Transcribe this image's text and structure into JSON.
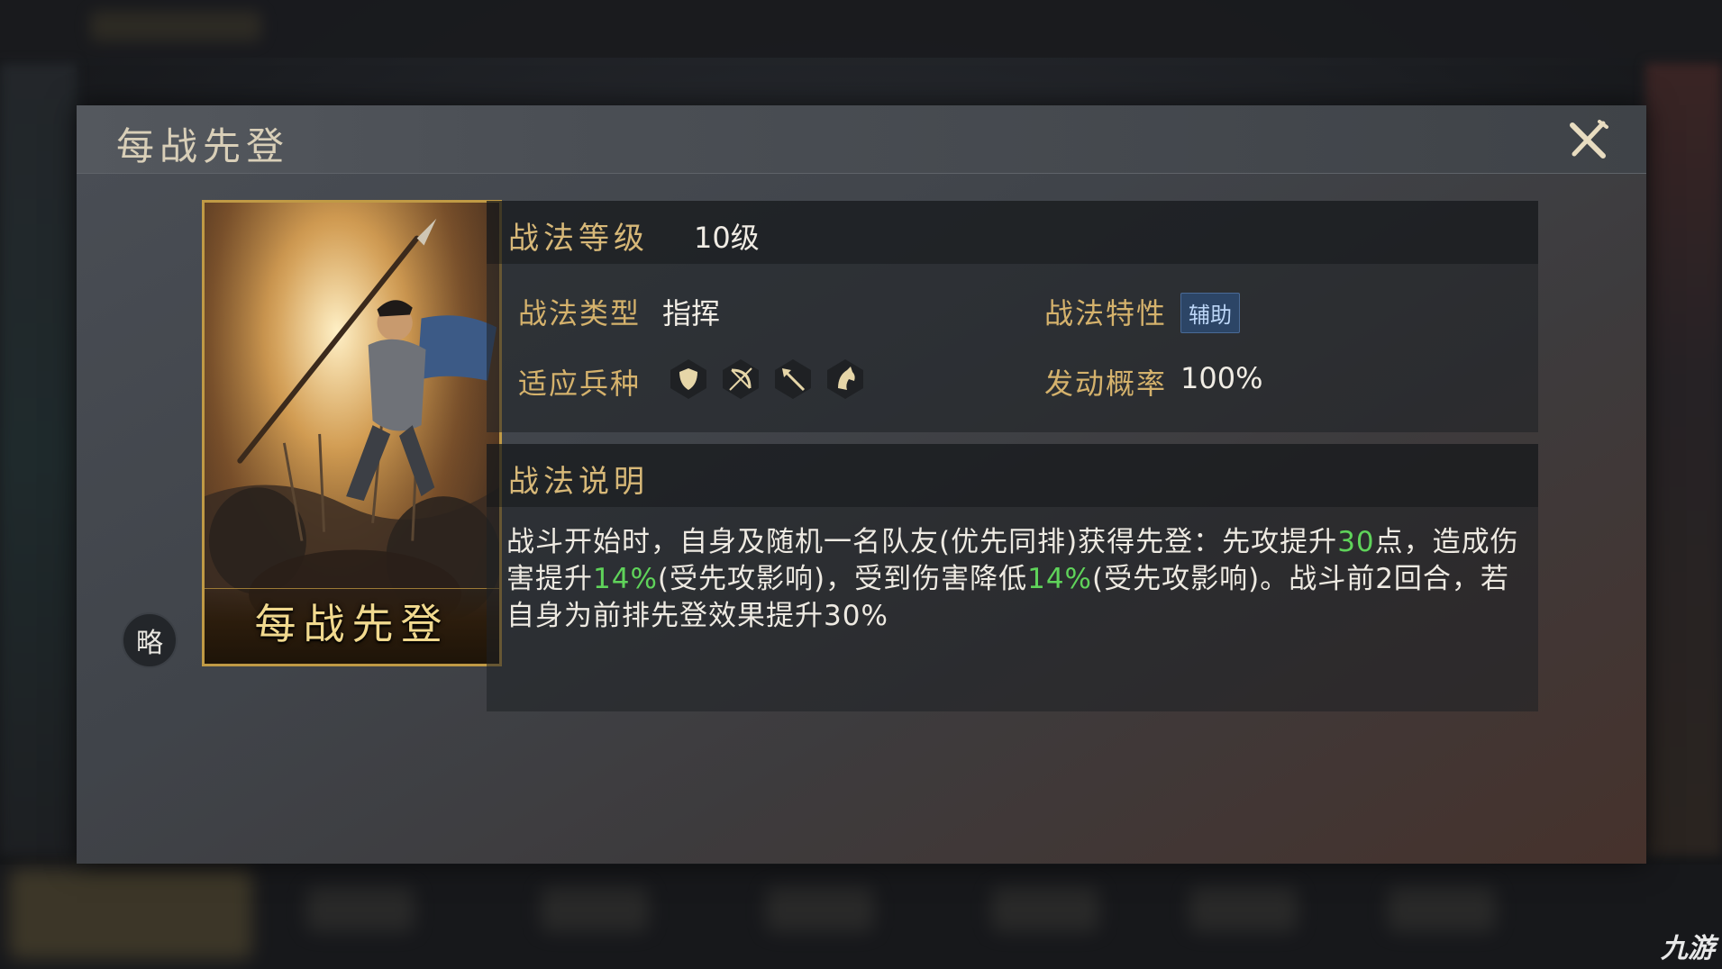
{
  "dialog": {
    "title": "每战先登",
    "close_icon": "close-x-icon"
  },
  "card": {
    "name": "每战先登",
    "badge": "略"
  },
  "level": {
    "label": "战法等级",
    "value": "10级"
  },
  "attributes": {
    "type_label": "战法类型",
    "type_value": "指挥",
    "trait_label": "战法特性",
    "trait_value": "辅助",
    "troops_label": "适应兵种",
    "troop_icons": [
      "shield-icon",
      "bow-icon",
      "spear-icon",
      "horse-icon"
    ],
    "rate_label": "发动概率",
    "rate_value": "100%"
  },
  "description": {
    "title": "战法说明",
    "part1": "战斗开始时，自身及随机一名队友(优先同排)获得先登：先攻提升",
    "hl1": "30",
    "part2": "点，造成伤害提升",
    "hl2": "14%",
    "part3": "(受先攻影响)，受到伤害降低",
    "hl3": "14%",
    "part4": "(受先攻影响)。战斗前2回合，若自身为前排先登效果提升30%"
  },
  "watermark": "九游",
  "colors": {
    "gold_label": "#d5b26c",
    "highlight_green": "#5fd35a",
    "trait_badge_bg": "#2c4566",
    "card_border": "#c09a45"
  }
}
